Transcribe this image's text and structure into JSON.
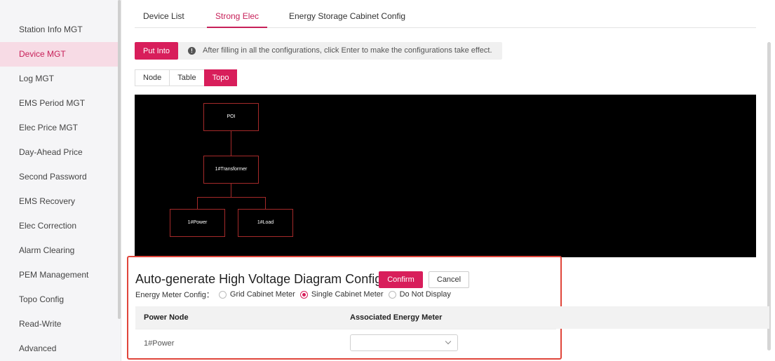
{
  "sidebar": {
    "items": [
      {
        "label": "Station Info MGT",
        "active": false
      },
      {
        "label": "Device MGT",
        "active": true
      },
      {
        "label": "Log MGT",
        "active": false
      },
      {
        "label": "EMS Period MGT",
        "active": false
      },
      {
        "label": "Elec Price MGT",
        "active": false
      },
      {
        "label": "Day-Ahead Price",
        "active": false
      },
      {
        "label": "Second Password",
        "active": false
      },
      {
        "label": "EMS Recovery",
        "active": false
      },
      {
        "label": "Elec Correction",
        "active": false
      },
      {
        "label": "Alarm Clearing",
        "active": false
      },
      {
        "label": "PEM Management",
        "active": false
      },
      {
        "label": "Topo Config",
        "active": false
      },
      {
        "label": "Read-Write",
        "active": false
      },
      {
        "label": "Advanced",
        "active": false
      }
    ]
  },
  "tabs": [
    {
      "label": "Device List",
      "active": false
    },
    {
      "label": "Strong Elec",
      "active": true
    },
    {
      "label": "Energy Storage Cabinet Config",
      "active": false
    }
  ],
  "toolbar": {
    "put_into_label": "Put Into",
    "info_text": "After filling in all the configurations, click Enter to make the configurations take effect."
  },
  "view_toggle": [
    {
      "label": "Node",
      "active": false
    },
    {
      "label": "Table",
      "active": false
    },
    {
      "label": "Topo",
      "active": true
    }
  ],
  "topo": {
    "nodes": {
      "poi": "POI",
      "transformer": "1#Transformer",
      "power": "1#Power",
      "load": "1#Load"
    }
  },
  "config": {
    "title": "Auto-generate High Voltage Diagram Config",
    "confirm_label": "Confirm",
    "cancel_label": "Cancel",
    "meter_config_label": "Energy Meter Config：",
    "meter_options": [
      {
        "label": "Grid Cabinet Meter",
        "checked": false
      },
      {
        "label": "Single Cabinet Meter",
        "checked": true
      },
      {
        "label": "Do Not Display",
        "checked": false
      }
    ],
    "table": {
      "headers": [
        "Power Node",
        "Associated Energy Meter"
      ],
      "rows": [
        {
          "power_node": "1#Power",
          "associated_meter": ""
        }
      ]
    }
  },
  "colors": {
    "accent": "#d81e5b",
    "active_sidebar_bg": "#f7dbe5",
    "highlight_border": "#e0453a",
    "topo_bg": "#000000",
    "topo_line": "#a52a2a"
  }
}
